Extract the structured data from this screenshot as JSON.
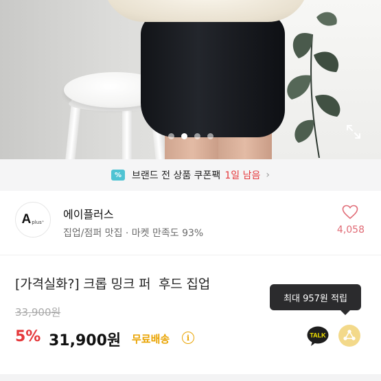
{
  "photo": {
    "carousel": {
      "count": 4,
      "active_index": 1
    },
    "expand_icon": "expand-icon"
  },
  "coupon_banner": {
    "icon": "coupon-icon",
    "text": "브랜드 전 상품 쿠폰팩",
    "highlight": "1일 남음",
    "chevron": "›",
    "highlight_color": "#e5383b"
  },
  "brand": {
    "logo_letter": "A",
    "logo_suffix": "plus⁺",
    "name": "에이플러스",
    "meta": "집업/점퍼 맛집 · 마켓 만족도 93%",
    "like_count": "4,058",
    "heart_color": "#e06a75"
  },
  "product": {
    "title": "[가격실화?] 크롭 밍크 퍼  후드 집업",
    "tooltip": "최대 957원 적립",
    "original_price": "33,900원",
    "discount": "5%",
    "price": "31,900원",
    "shipping": "무료배송",
    "info_icon_label": "i",
    "talk_label": "TALK",
    "accent_color": "#e9a300"
  }
}
